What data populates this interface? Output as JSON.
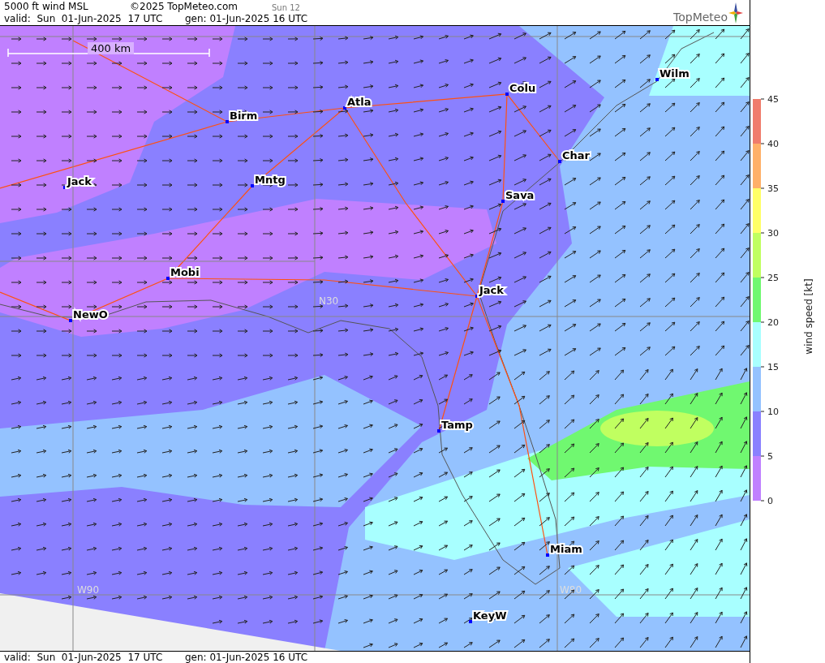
{
  "header": {
    "title": "5000 ft wind MSL",
    "copyright": "©2025 TopMeteo.com",
    "run": "Sun 12",
    "valid": "valid:  Sun  01-Jun-2025  17 UTC",
    "generated": "gen: 01-Jun-2025 16 UTC",
    "logo": "TopMeteo"
  },
  "map": {
    "scale": "400 km",
    "grid_labels": [
      "N30",
      "W90",
      "W80"
    ],
    "cities": [
      {
        "name": "Wilm"
      },
      {
        "name": "Colu"
      },
      {
        "name": "Atla"
      },
      {
        "name": "Birm"
      },
      {
        "name": "Char"
      },
      {
        "name": "Jack"
      },
      {
        "name": "Mntg"
      },
      {
        "name": "Sava"
      },
      {
        "name": "Mobi"
      },
      {
        "name": "Jack"
      },
      {
        "name": "NewO"
      },
      {
        "name": "Tamp"
      },
      {
        "name": "Miam"
      },
      {
        "name": "KeyW"
      }
    ]
  },
  "legend": {
    "title": "wind speed [kt]",
    "ticks": [
      "45",
      "40",
      "35",
      "30",
      "25",
      "20",
      "15",
      "10",
      "5",
      "0"
    ],
    "bands": [
      {
        "color": "#f07c6c"
      },
      {
        "color": "#ffb068"
      },
      {
        "color": "#ffff66"
      },
      {
        "color": "#c0ff60"
      },
      {
        "color": "#70f870"
      },
      {
        "color": "#a8ffff"
      },
      {
        "color": "#94c2ff"
      },
      {
        "color": "#8a80ff"
      },
      {
        "color": "#c080ff"
      }
    ]
  },
  "footer": {
    "valid": "valid:  Sun  01-Jun-2025  17 UTC",
    "generated": "gen: 01-Jun-2025 16 UTC"
  }
}
